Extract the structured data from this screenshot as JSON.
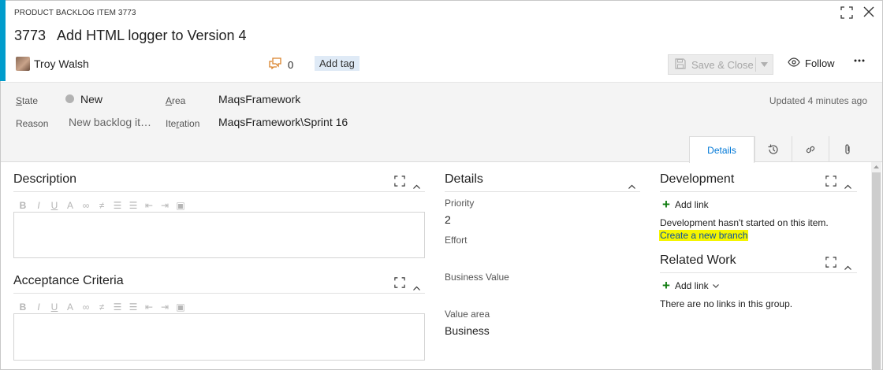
{
  "header": {
    "work_item_type": "PRODUCT BACKLOG ITEM 3773",
    "id": "3773",
    "title": "Add HTML logger to Version 4",
    "assignee": "Troy Walsh",
    "comment_count": "0",
    "add_tag_label": "Add tag",
    "save_close_label": "Save & Close",
    "follow_label": "Follow",
    "more_label": "•••"
  },
  "fields": {
    "state_label_underlined": "S",
    "state_label_rest": "tate",
    "state_value": "New",
    "area_label_underlined": "A",
    "area_label_rest": "rea",
    "area_value": "MaqsFramework",
    "reason_label": "Reason",
    "reason_value": "New backlog it…",
    "iteration_label_pre": "Ite",
    "iteration_label_underlined": "r",
    "iteration_label_rest": "ation",
    "iteration_value": "MaqsFramework\\Sprint 16",
    "updated": "Updated 4 minutes ago"
  },
  "tabs": {
    "details_label": "Details",
    "icons": [
      "history-icon",
      "link-icon",
      "attachment-icon"
    ]
  },
  "description": {
    "title": "Description",
    "toolbar": [
      "bold-icon",
      "italic-icon",
      "underline-icon",
      "highlight-icon",
      "link-icon",
      "unlink-icon",
      "bullet-list-icon",
      "numbered-list-icon",
      "outdent-icon",
      "indent-icon",
      "image-icon"
    ],
    "toolbar_glyphs": [
      "B",
      "I",
      "U",
      "A",
      "∞",
      "≠",
      "☰",
      "☰",
      "⇤",
      "⇥",
      "▣"
    ]
  },
  "acceptance": {
    "title": "Acceptance Criteria",
    "toolbar_glyphs": [
      "B",
      "I",
      "U",
      "A",
      "∞",
      "≠",
      "☰",
      "☰",
      "⇤",
      "⇥",
      "▣"
    ]
  },
  "details": {
    "title": "Details",
    "priority_label": "Priority",
    "priority_value": "2",
    "effort_label": "Effort",
    "effort_value": "",
    "business_value_label": "Business Value",
    "business_value_value": "",
    "value_area_label": "Value area",
    "value_area_value": "Business"
  },
  "development": {
    "title": "Development",
    "add_link_label": "Add link",
    "status_text": "Development hasn't started on this item.",
    "create_branch_label": "Create a new branch"
  },
  "related_work": {
    "title": "Related Work",
    "add_link_label": "Add link",
    "empty_text": "There are no links in this group."
  },
  "colors": {
    "accent": "#009ccc",
    "link": "#0a4fa0",
    "highlight": "#f5f500",
    "add_green": "#107c10",
    "comment_orange": "#d9822b"
  }
}
